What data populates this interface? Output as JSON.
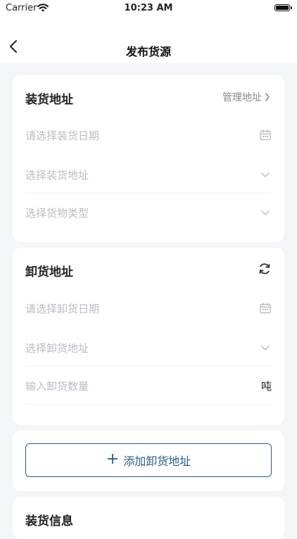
{
  "status": {
    "carrier": "Carrier",
    "time": "10:23 AM"
  },
  "nav": {
    "title": "发布货源"
  },
  "loading": {
    "title": "装货地址",
    "manage_label": "管理地址",
    "date_placeholder": "请选择装货日期",
    "address_placeholder": "选择装货地址",
    "cargo_type_placeholder": "选择货物类型"
  },
  "unloading": {
    "title": "卸货地址",
    "date_placeholder": "请选择卸货日期",
    "address_placeholder": "选择卸货地址",
    "quantity_placeholder": "输入卸货数量",
    "unit": "吨"
  },
  "add_unload_button": {
    "plus": "+",
    "label": "添加卸货地址"
  },
  "cargo_info": {
    "title": "装货信息"
  },
  "colors": {
    "accent": "#2b5c8a",
    "placeholder": "#b8bcc4",
    "background": "#f4f5f8"
  }
}
